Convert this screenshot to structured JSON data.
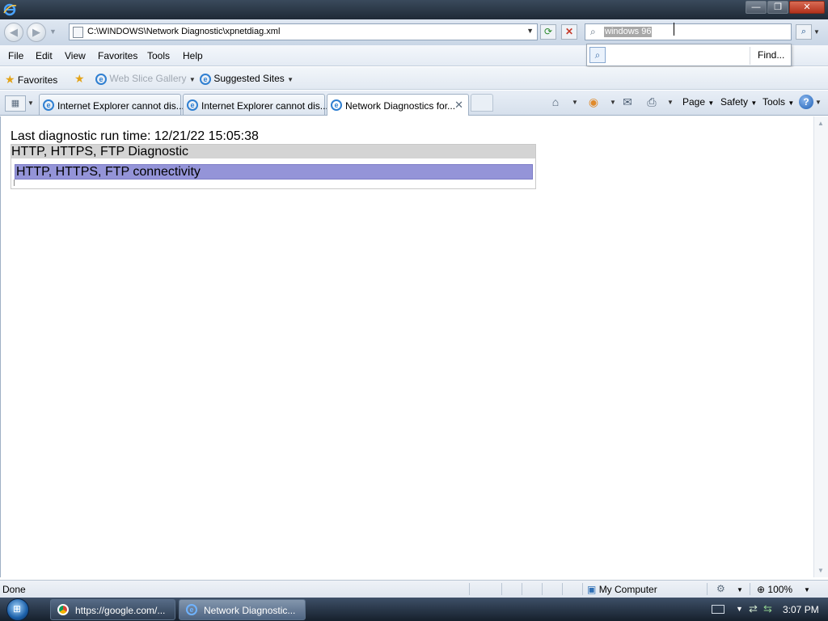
{
  "window": {
    "minimize": "—",
    "restore": "❐",
    "close": "✕"
  },
  "address": {
    "url": "C:\\WINDOWS\\Network Diagnostic\\xpnetdiag.xml",
    "search_value": "windows 96"
  },
  "menu": [
    "File",
    "Edit",
    "View",
    "Favorites",
    "Tools",
    "Help"
  ],
  "suggest": {
    "find_label": "Find..."
  },
  "favorites_bar": {
    "favorites_label": "Favorites",
    "web_slice_label": "Web Slice Gallery",
    "suggested_label": "Suggested Sites"
  },
  "tabs": [
    {
      "label": "Internet Explorer cannot dis..."
    },
    {
      "label": "Internet Explorer cannot dis..."
    },
    {
      "label": "Network Diagnostics for..."
    }
  ],
  "command_bar": {
    "page_label": "Page",
    "safety_label": "Safety",
    "tools_label": "Tools",
    "help_label": "?"
  },
  "content": {
    "run_time": "Last diagnostic run time: 12/21/22 15:05:38",
    "section_title": "HTTP, HTTPS, FTP Diagnostic",
    "row_label": "HTTP, HTTPS, FTP connectivity"
  },
  "status": {
    "text": "Done",
    "zone": "My Computer",
    "zoom": "100%"
  },
  "taskbar": {
    "items": [
      {
        "label": "https://google.com/..."
      },
      {
        "label": "Network Diagnostic..."
      }
    ],
    "clock": "3:07 PM"
  },
  "colors": {
    "row_highlight": "#9494d8",
    "section_header": "#d4d4d4"
  }
}
